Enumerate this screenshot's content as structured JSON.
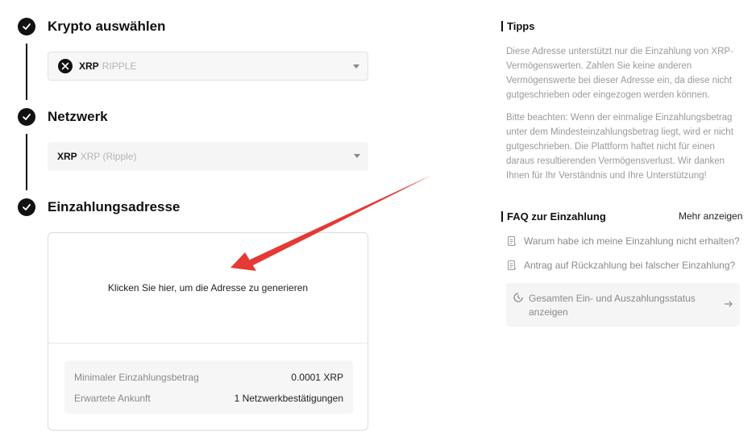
{
  "steps": [
    {
      "title": "Krypto auswählen"
    },
    {
      "title": "Netzwerk"
    },
    {
      "title": "Einzahlungsadresse"
    }
  ],
  "coin_select": {
    "symbol": "XRP",
    "name": "RIPPLE"
  },
  "network_select": {
    "symbol": "XRP",
    "name": "XRP (Ripple)"
  },
  "address": {
    "generate_text": "Klicken Sie hier, um die Adresse zu generieren",
    "min_label": "Minimaler Einzahlungsbetrag",
    "min_value": "0.0001 XRP",
    "arrival_label": "Erwartete Ankunft",
    "arrival_value": "1 Netzwerkbestätigungen"
  },
  "tips": {
    "title": "Tipps",
    "para1": "Diese Adresse unterstützt nur die Einzahlung von XRP-Vermögenswerten. Zahlen Sie keine anderen Vermögenswerte bei dieser Adresse ein, da diese nicht gutgeschrieben oder eingezogen werden können.",
    "para2": "Bitte beachten: Wenn der einmalige Einzahlungsbetrag unter dem Mindesteinzahlungsbetrag liegt, wird er nicht gutgeschrieben. Die Plattform haftet nicht für einen daraus resultierenden Vermögensverlust. Wir danken Ihnen für Ihr Verständnis und Ihre Unterstützung!"
  },
  "faq": {
    "title": "FAQ zur Einzahlung",
    "more": "Mehr anzeigen",
    "items": [
      "Warum habe ich meine Einzahlung nicht erhalten?",
      "Antrag auf Rückzahlung bei falscher Einzahlung?"
    ],
    "status": "Gesamten Ein- und Auszahlungsstatus anzeigen"
  },
  "colors": {
    "accent": "#111111",
    "annotation_arrow": "#e53935",
    "muted_text": "#9a9a9a"
  },
  "icons": [
    "check-icon",
    "xrp-coin-icon",
    "chevron-down-icon",
    "document-icon",
    "clock-icon",
    "arrow-right-icon"
  ]
}
